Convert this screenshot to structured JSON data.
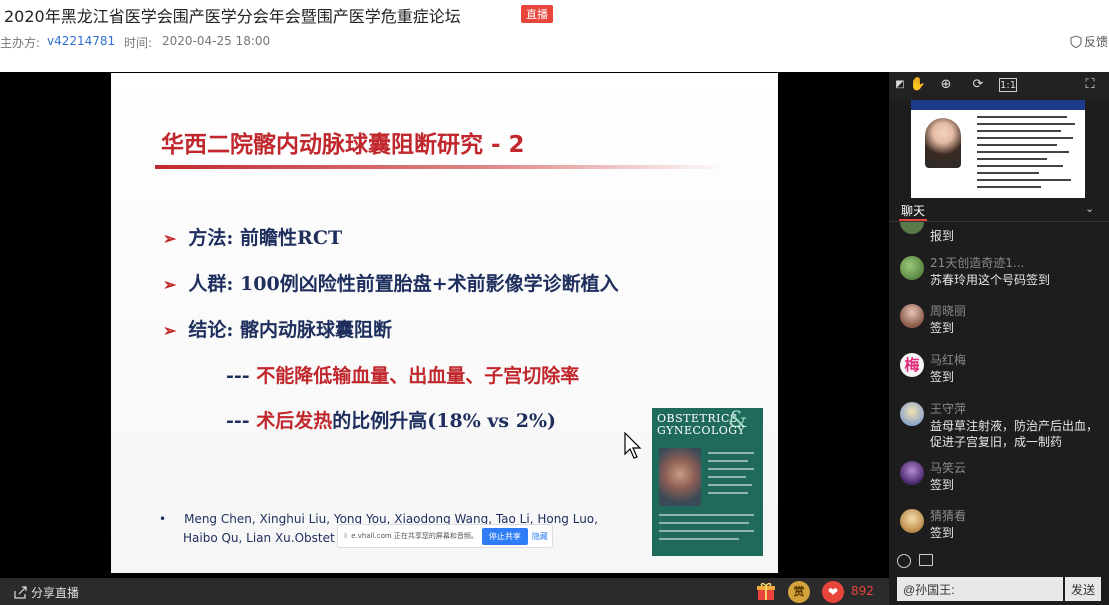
{
  "header": {
    "title": "2020年黑龙江省医学会围产医学分会年会暨围产医学危重症论坛",
    "live_badge": "直播",
    "host_label": "主办方:",
    "host_id": "v42214781",
    "time_label": "时间:",
    "time_value": "2020-04-25 18:00",
    "feedback": "反馈"
  },
  "slide": {
    "title": "华西二院髂内动脉球囊阻断研究 - 2",
    "bullets": [
      {
        "arrow": "➢",
        "text": "方法: 前瞻性RCT"
      },
      {
        "arrow": "➢",
        "text": "人群: 100例凶险性前置胎盘+术前影像学诊断植入"
      },
      {
        "arrow": "➢",
        "text": "结论: 髂内动脉球囊阻断"
      }
    ],
    "conclusion1_prefix": "--- ",
    "conclusion1_red": "不能降低输血量、出血量、子宫切除率",
    "conclusion2_prefix": "--- ",
    "conclusion2_red": "术后发热",
    "conclusion2_rest": "的比例升高(18% vs 2%)",
    "reference_bullet": "•",
    "reference_line1": "Meng Chen, Xinghui Liu, Yong You, Xiaodong Wang, Tao Li, Hong Luo,",
    "reference_line2": "Haibo Qu, Lian Xu.Obstet G",
    "journal_line1": "OBSTETRICS",
    "journal_amp": "&",
    "journal_line2": "GYNECOLOGY",
    "share_text": "e.vhall.com 正在共享您的屏幕和音频。",
    "stop_share": "停止共享",
    "hide_share": "隐藏"
  },
  "bottom": {
    "share_live": "分享直播",
    "reward": "赏",
    "like_count": "892"
  },
  "panel": {
    "chat_tab": "聊天",
    "messages": [
      {
        "name": "",
        "text": "报到",
        "avatar_color": "#5b7a4a"
      },
      {
        "name": "21天创造奇迹1...",
        "text": "苏春玲用这个号码签到",
        "avatar_color": "#4f8a3c"
      },
      {
        "name": "周晓丽",
        "text": "签到",
        "avatar_color": "#b07a6a"
      },
      {
        "name": "马红梅",
        "text": "签到",
        "avatar_color": "#f5f5f5",
        "avatar_glyph": "梅"
      },
      {
        "name": "王守萍",
        "text": "益母草注射液，防治产后出血，",
        "text2": "促进子宫复旧，成一制药",
        "avatar_color": "#8fa6c8"
      },
      {
        "name": "马笑云",
        "text": "签到",
        "avatar_color": "#6a3d8a"
      },
      {
        "name": "猜猜看",
        "text": "签到",
        "avatar_color": "#d9b27a"
      }
    ],
    "input_value": "@孙国王:",
    "send_label": "发送"
  }
}
